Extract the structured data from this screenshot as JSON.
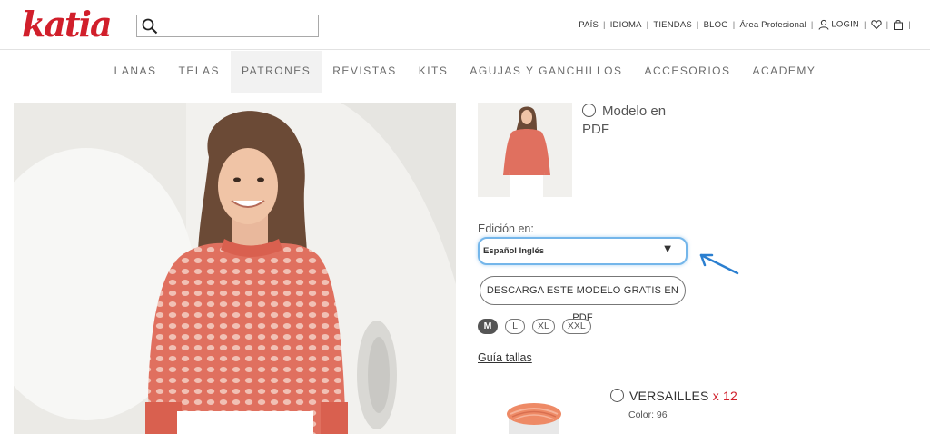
{
  "header": {
    "logo_text": "katia",
    "logo_registered": "®",
    "search": {
      "placeholder": "",
      "value": ""
    },
    "links": [
      "PAÍS",
      "IDIOMA",
      "TIENDAS",
      "BLOG",
      "Área Profesional"
    ],
    "login_label": "LOGIN"
  },
  "nav": {
    "items": [
      "LANAS",
      "TELAS",
      "PATRONES",
      "REVISTAS",
      "KITS",
      "AGUJAS Y GANCHILLOS",
      "ACCESORIOS",
      "ACADEMY"
    ],
    "active": "PATRONES"
  },
  "product": {
    "model_option_label": "Modelo en PDF",
    "edition_label": "Edición en:",
    "edition_value": "Español Inglés",
    "download_label": "DESCARGA ESTE MODELO GRATIS EN PDF",
    "sizes": [
      "M",
      "L",
      "XL",
      "XXL"
    ],
    "selected_size": "M",
    "size_guide_label": "Guía tallas",
    "yarn": {
      "name": "VERSAILLES",
      "quantity": "x 12",
      "color_label": "Color: 96"
    }
  },
  "colors": {
    "brand": "#d11f2b",
    "select_focus": "#74b6ea",
    "annotation_arrow": "#2b7fd0",
    "sweater": "#e0705f"
  },
  "icons": [
    "search-icon",
    "user-icon",
    "heart-icon",
    "bag-icon",
    "chevron-down-icon",
    "annotation-arrow"
  ]
}
